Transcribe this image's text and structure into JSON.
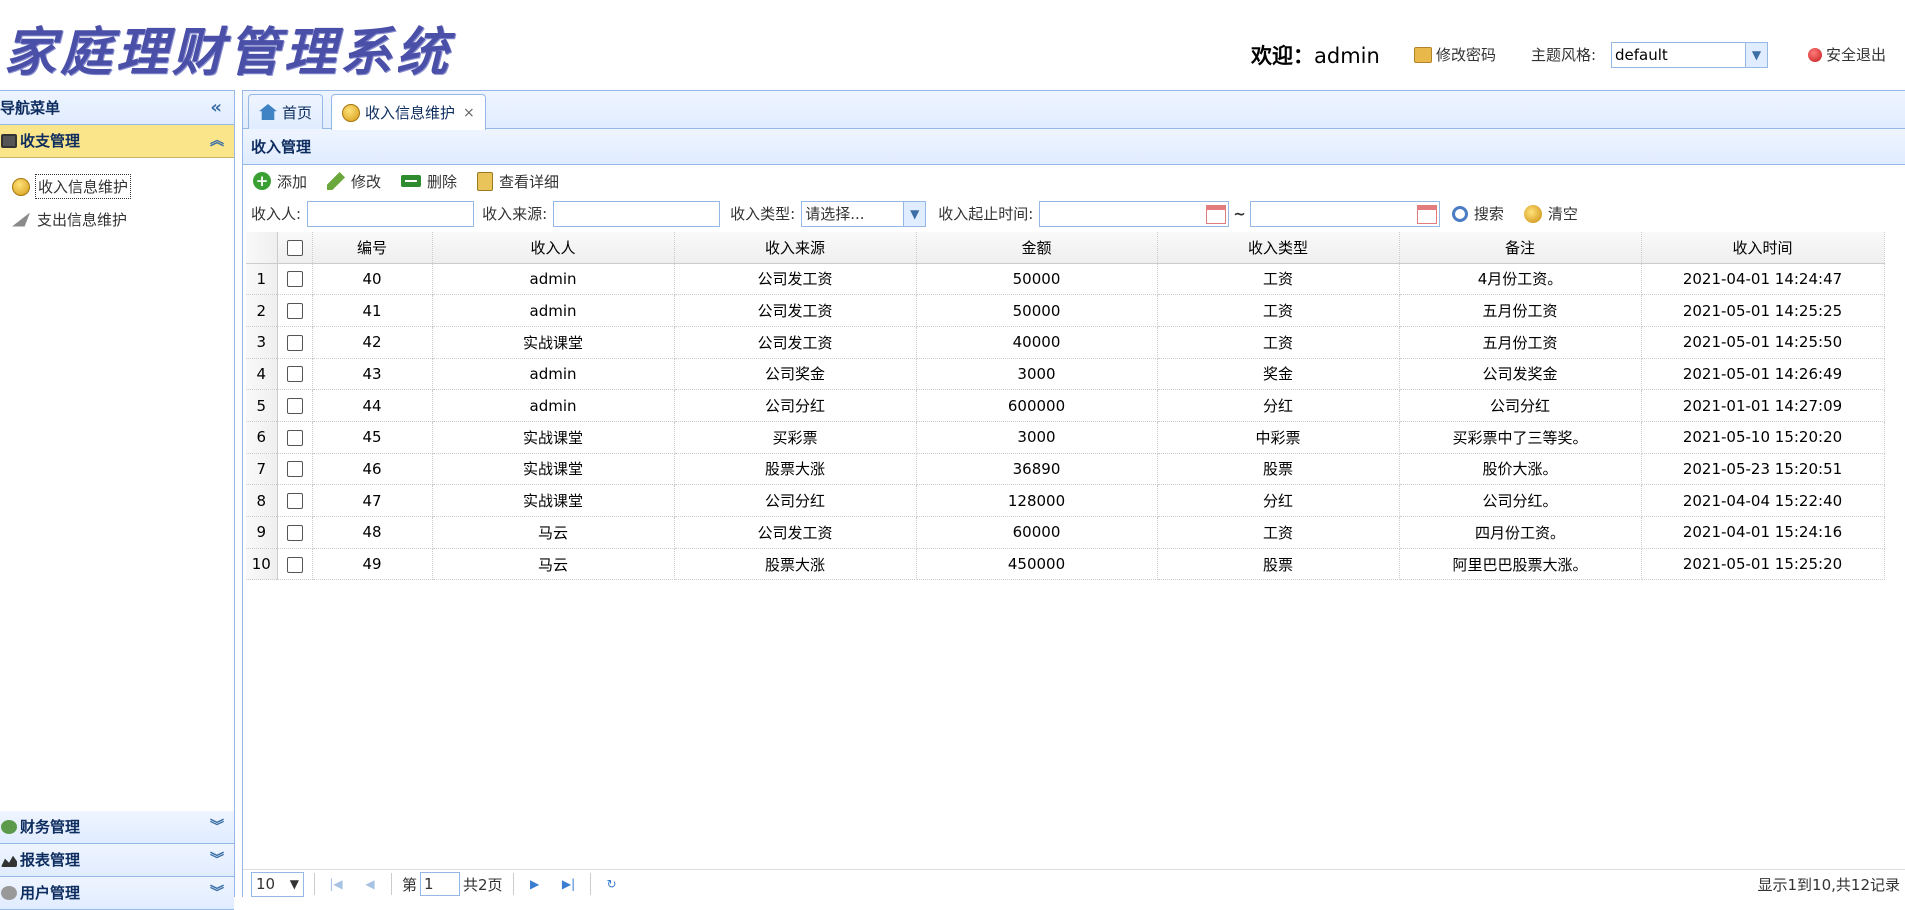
{
  "header": {
    "logo_text": "家庭理财管理系统",
    "welcome_label": "欢迎：",
    "welcome_user": "admin",
    "change_password": "修改密码",
    "theme_label": "主题风格:",
    "theme_value": "default",
    "logout": "安全退出"
  },
  "nav": {
    "title": "导航菜单",
    "sections": [
      {
        "label": "收支管理",
        "active": true,
        "items": [
          {
            "label": "收入信息维护",
            "icon": "coin-icon"
          },
          {
            "label": "支出信息维护",
            "icon": "plane-icon"
          }
        ]
      },
      {
        "label": "财务管理",
        "active": false
      },
      {
        "label": "报表管理",
        "active": false
      },
      {
        "label": "用户管理",
        "active": false
      }
    ]
  },
  "tabs": [
    {
      "label": "首页",
      "icon": "home-icon",
      "active": false,
      "closable": false
    },
    {
      "label": "收入信息维护",
      "icon": "coin-icon",
      "active": true,
      "closable": true
    }
  ],
  "panel": {
    "title": "收入管理",
    "toolbar": {
      "add": "添加",
      "edit": "修改",
      "delete": "删除",
      "detail": "查看详细"
    },
    "filters": {
      "person_label": "收入人:",
      "source_label": "收入来源:",
      "type_label": "收入类型:",
      "type_placeholder": "请选择...",
      "time_label": "收入起止时间:",
      "range_sep": "~",
      "search": "搜索",
      "clear": "清空"
    }
  },
  "grid": {
    "columns": [
      "编号",
      "收入人",
      "收入来源",
      "金额",
      "收入类型",
      "备注",
      "收入时间"
    ],
    "rows": [
      [
        "40",
        "admin",
        "公司发工资",
        "50000",
        "工资",
        "4月份工资。",
        "2021-04-01 14:24:47"
      ],
      [
        "41",
        "admin",
        "公司发工资",
        "50000",
        "工资",
        "五月份工资",
        "2021-05-01 14:25:25"
      ],
      [
        "42",
        "实战课堂",
        "公司发工资",
        "40000",
        "工资",
        "五月份工资",
        "2021-05-01 14:25:50"
      ],
      [
        "43",
        "admin",
        "公司奖金",
        "3000",
        "奖金",
        "公司发奖金",
        "2021-05-01 14:26:49"
      ],
      [
        "44",
        "admin",
        "公司分红",
        "600000",
        "分红",
        "公司分红",
        "2021-01-01 14:27:09"
      ],
      [
        "45",
        "实战课堂",
        "买彩票",
        "3000",
        "中彩票",
        "买彩票中了三等奖。",
        "2021-05-10 15:20:20"
      ],
      [
        "46",
        "实战课堂",
        "股票大涨",
        "36890",
        "股票",
        "股价大涨。",
        "2021-05-23 15:20:51"
      ],
      [
        "47",
        "实战课堂",
        "公司分红",
        "128000",
        "分红",
        "公司分红。",
        "2021-04-04 15:22:40"
      ],
      [
        "48",
        "马云",
        "公司发工资",
        "60000",
        "工资",
        "四月份工资。",
        "2021-04-01 15:24:16"
      ],
      [
        "49",
        "马云",
        "股票大涨",
        "450000",
        "股票",
        "阿里巴巴股票大涨。",
        "2021-05-01 15:25:20"
      ]
    ]
  },
  "pager": {
    "page_size": "10",
    "page_prefix": "第",
    "page_number": "1",
    "page_total": "共2页",
    "info": "显示1到10,共12记录"
  }
}
